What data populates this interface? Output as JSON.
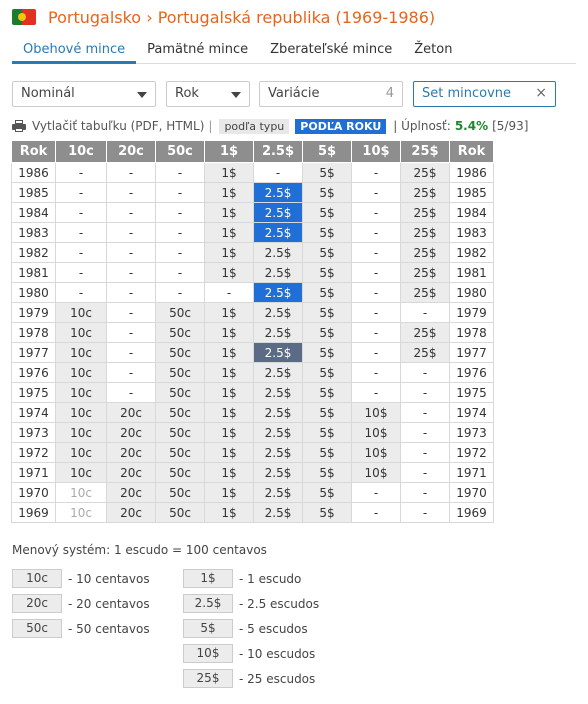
{
  "header": {
    "country": "Portugalsko",
    "separator": "›",
    "period": "Portugalská republika (1969-1986)"
  },
  "tabs": [
    {
      "label": "Obehové mince",
      "active": true
    },
    {
      "label": "Pamätné mince",
      "active": false
    },
    {
      "label": "Zberateľské mince",
      "active": false
    },
    {
      "label": "Žeton",
      "active": false
    }
  ],
  "filters": {
    "nominal": "Nominál",
    "year": "Rok",
    "variation": "Variácie",
    "variation_count": "4",
    "set": "Set mincovne",
    "clear": "×"
  },
  "toolbar": {
    "print": "Vytlačiť tabuľku (PDF, HTML)",
    "sep": "|",
    "by_type": "podľa typu",
    "by_year": "PODĽA ROKU",
    "sep2": "| Úplnosť:",
    "completeness": "5.4%",
    "count": "[5/93]"
  },
  "table": {
    "headers": [
      "Rok",
      "10c",
      "20c",
      "50c",
      "1$",
      "2.5$",
      "5$",
      "10$",
      "25$",
      "Rok"
    ],
    "rows": [
      {
        "year": "1986",
        "cells": [
          [
            "-",
            "d"
          ],
          [
            "-",
            "d"
          ],
          [
            "-",
            "d"
          ],
          [
            "1$",
            "c"
          ],
          [
            "-",
            "d"
          ],
          [
            "5$",
            "c"
          ],
          [
            "-",
            "d"
          ],
          [
            "25$",
            "c"
          ]
        ]
      },
      {
        "year": "1985",
        "cells": [
          [
            "-",
            "d"
          ],
          [
            "-",
            "d"
          ],
          [
            "-",
            "d"
          ],
          [
            "1$",
            "c"
          ],
          [
            "2.5$",
            "b"
          ],
          [
            "5$",
            "c"
          ],
          [
            "-",
            "d"
          ],
          [
            "25$",
            "c"
          ]
        ]
      },
      {
        "year": "1984",
        "cells": [
          [
            "-",
            "d"
          ],
          [
            "-",
            "d"
          ],
          [
            "-",
            "d"
          ],
          [
            "1$",
            "c"
          ],
          [
            "2.5$",
            "b"
          ],
          [
            "5$",
            "c"
          ],
          [
            "-",
            "d"
          ],
          [
            "25$",
            "c"
          ]
        ]
      },
      {
        "year": "1983",
        "cells": [
          [
            "-",
            "d"
          ],
          [
            "-",
            "d"
          ],
          [
            "-",
            "d"
          ],
          [
            "1$",
            "c"
          ],
          [
            "2.5$",
            "b"
          ],
          [
            "5$",
            "c"
          ],
          [
            "-",
            "d"
          ],
          [
            "25$",
            "c"
          ]
        ]
      },
      {
        "year": "1982",
        "cells": [
          [
            "-",
            "d"
          ],
          [
            "-",
            "d"
          ],
          [
            "-",
            "d"
          ],
          [
            "1$",
            "c"
          ],
          [
            "2.5$",
            "c"
          ],
          [
            "5$",
            "c"
          ],
          [
            "-",
            "d"
          ],
          [
            "25$",
            "c"
          ]
        ]
      },
      {
        "year": "1981",
        "cells": [
          [
            "-",
            "d"
          ],
          [
            "-",
            "d"
          ],
          [
            "-",
            "d"
          ],
          [
            "1$",
            "c"
          ],
          [
            "2.5$",
            "c"
          ],
          [
            "5$",
            "c"
          ],
          [
            "-",
            "d"
          ],
          [
            "25$",
            "c"
          ]
        ]
      },
      {
        "year": "1980",
        "cells": [
          [
            "-",
            "d"
          ],
          [
            "-",
            "d"
          ],
          [
            "-",
            "d"
          ],
          [
            "-",
            "d"
          ],
          [
            "2.5$",
            "b"
          ],
          [
            "5$",
            "c"
          ],
          [
            "-",
            "d"
          ],
          [
            "25$",
            "c"
          ]
        ]
      },
      {
        "year": "1979",
        "cells": [
          [
            "10c",
            "c"
          ],
          [
            "-",
            "d"
          ],
          [
            "50c",
            "c"
          ],
          [
            "1$",
            "c"
          ],
          [
            "2.5$",
            "c"
          ],
          [
            "5$",
            "c"
          ],
          [
            "-",
            "d"
          ],
          [
            "-",
            "d"
          ]
        ]
      },
      {
        "year": "1978",
        "cells": [
          [
            "10c",
            "c"
          ],
          [
            "-",
            "d"
          ],
          [
            "50c",
            "c"
          ],
          [
            "1$",
            "c"
          ],
          [
            "2.5$",
            "c"
          ],
          [
            "5$",
            "c"
          ],
          [
            "-",
            "d"
          ],
          [
            "25$",
            "c"
          ]
        ]
      },
      {
        "year": "1977",
        "cells": [
          [
            "10c",
            "c"
          ],
          [
            "-",
            "d"
          ],
          [
            "50c",
            "c"
          ],
          [
            "1$",
            "c"
          ],
          [
            "2.5$",
            "k"
          ],
          [
            "5$",
            "c"
          ],
          [
            "-",
            "d"
          ],
          [
            "25$",
            "c"
          ]
        ]
      },
      {
        "year": "1976",
        "cells": [
          [
            "10c",
            "c"
          ],
          [
            "-",
            "d"
          ],
          [
            "50c",
            "c"
          ],
          [
            "1$",
            "c"
          ],
          [
            "2.5$",
            "c"
          ],
          [
            "5$",
            "c"
          ],
          [
            "-",
            "d"
          ],
          [
            "-",
            "d"
          ]
        ]
      },
      {
        "year": "1975",
        "cells": [
          [
            "10c",
            "c"
          ],
          [
            "-",
            "d"
          ],
          [
            "50c",
            "c"
          ],
          [
            "1$",
            "c"
          ],
          [
            "2.5$",
            "c"
          ],
          [
            "5$",
            "c"
          ],
          [
            "-",
            "d"
          ],
          [
            "-",
            "d"
          ]
        ]
      },
      {
        "year": "1974",
        "cells": [
          [
            "10c",
            "c"
          ],
          [
            "20c",
            "c"
          ],
          [
            "50c",
            "c"
          ],
          [
            "1$",
            "c"
          ],
          [
            "2.5$",
            "c"
          ],
          [
            "5$",
            "c"
          ],
          [
            "10$",
            "c"
          ],
          [
            "-",
            "d"
          ]
        ]
      },
      {
        "year": "1973",
        "cells": [
          [
            "10c",
            "c"
          ],
          [
            "20c",
            "c"
          ],
          [
            "50c",
            "c"
          ],
          [
            "1$",
            "c"
          ],
          [
            "2.5$",
            "c"
          ],
          [
            "5$",
            "c"
          ],
          [
            "10$",
            "c"
          ],
          [
            "-",
            "d"
          ]
        ]
      },
      {
        "year": "1972",
        "cells": [
          [
            "10c",
            "c"
          ],
          [
            "20c",
            "c"
          ],
          [
            "50c",
            "c"
          ],
          [
            "1$",
            "c"
          ],
          [
            "2.5$",
            "c"
          ],
          [
            "5$",
            "c"
          ],
          [
            "10$",
            "c"
          ],
          [
            "-",
            "d"
          ]
        ]
      },
      {
        "year": "1971",
        "cells": [
          [
            "10c",
            "c"
          ],
          [
            "20c",
            "c"
          ],
          [
            "50c",
            "c"
          ],
          [
            "1$",
            "c"
          ],
          [
            "2.5$",
            "c"
          ],
          [
            "5$",
            "c"
          ],
          [
            "10$",
            "c"
          ],
          [
            "-",
            "d"
          ]
        ]
      },
      {
        "year": "1970",
        "cells": [
          [
            "10c",
            "l"
          ],
          [
            "20c",
            "c"
          ],
          [
            "50c",
            "c"
          ],
          [
            "1$",
            "c"
          ],
          [
            "2.5$",
            "c"
          ],
          [
            "5$",
            "c"
          ],
          [
            "-",
            "d"
          ],
          [
            "-",
            "d"
          ]
        ]
      },
      {
        "year": "1969",
        "cells": [
          [
            "10c",
            "l"
          ],
          [
            "20c",
            "c"
          ],
          [
            "50c",
            "c"
          ],
          [
            "1$",
            "c"
          ],
          [
            "2.5$",
            "c"
          ],
          [
            "5$",
            "c"
          ],
          [
            "-",
            "d"
          ],
          [
            "-",
            "d"
          ]
        ]
      }
    ]
  },
  "system": "Menový systém: 1 escudo = 100 centavos",
  "legend_left": [
    {
      "code": "10c",
      "text": "- 10 centavos"
    },
    {
      "code": "20c",
      "text": "- 20 centavos"
    },
    {
      "code": "50c",
      "text": "- 50 centavos"
    }
  ],
  "legend_right": [
    {
      "code": "1$",
      "text": "- 1 escudo"
    },
    {
      "code": "2.5$",
      "text": "- 2.5 escudos"
    },
    {
      "code": "5$",
      "text": "- 5 escudos"
    },
    {
      "code": "10$",
      "text": "- 10 escudos"
    },
    {
      "code": "25$",
      "text": "- 25 escudos"
    }
  ],
  "colors": {
    "accent": "#e8641b",
    "tab": "#2a7ab0",
    "selected": "#1f6fd6",
    "missing": "#5b6b86",
    "progress": "#1a8a2a"
  }
}
